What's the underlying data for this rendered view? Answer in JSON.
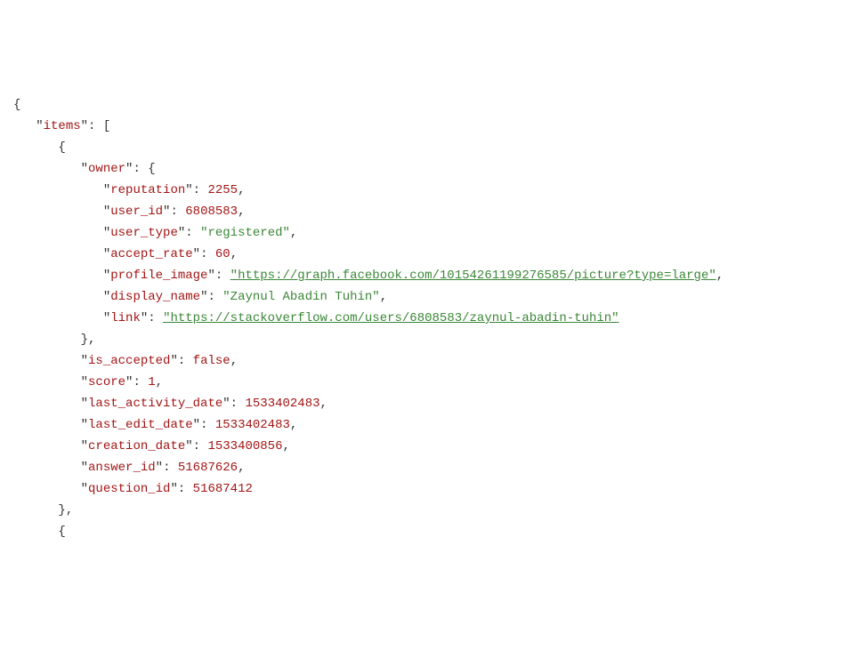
{
  "keys": {
    "items": "items",
    "owner": "owner",
    "reputation": "reputation",
    "user_id": "user_id",
    "user_type": "user_type",
    "accept_rate": "accept_rate",
    "profile_image": "profile_image",
    "display_name": "display_name",
    "link": "link",
    "is_accepted": "is_accepted",
    "score": "score",
    "last_activity_date": "last_activity_date",
    "last_edit_date": "last_edit_date",
    "creation_date": "creation_date",
    "answer_id": "answer_id",
    "question_id": "question_id"
  },
  "values": {
    "reputation": "2255",
    "user_id": "6808583",
    "user_type": "\"registered\"",
    "accept_rate": "60",
    "profile_image": "\"https://graph.facebook.com/10154261199276585/picture?type=large\"",
    "display_name": "\"Zaynul Abadin Tuhin\"",
    "link": "\"https://stackoverflow.com/users/6808583/zaynul-abadin-tuhin\"",
    "is_accepted": "false",
    "score": "1",
    "last_activity_date": "1533402483",
    "last_edit_date": "1533402483",
    "creation_date": "1533400856",
    "answer_id": "51687626",
    "question_id": "51687412"
  },
  "punct": {
    "open_brace": "{",
    "close_brace": "}",
    "close_brace_comma": "},",
    "open_bracket": "[",
    "colon_space": ": ",
    "comma": ",",
    "quote": "\""
  }
}
